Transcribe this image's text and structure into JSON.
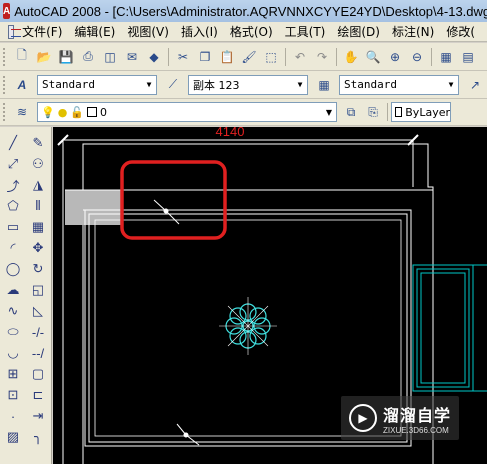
{
  "window": {
    "title": "AutoCAD 2008 - [C:\\Users\\Administrator.AQRVNNXCYYE24YD\\Desktop\\4-13.dwg"
  },
  "menubar": {
    "items": [
      "文件(F)",
      "编辑(E)",
      "视图(V)",
      "插入(I)",
      "格式(O)",
      "工具(T)",
      "绘图(D)",
      "标注(N)",
      "修改("
    ]
  },
  "styles_toolbar": {
    "text_style": "Standard",
    "dim_style": "副本 123",
    "table_style": "Standard"
  },
  "layers_toolbar": {
    "current_layer": "0",
    "color_control": "ByLayer"
  },
  "drawing": {
    "dimension_text": "4140",
    "colors": {
      "background": "#000000",
      "walls": "#ffffff",
      "window": "#00c8c8",
      "fixture": "#40e0e0",
      "highlight": "#e02020",
      "dimension": "#e02020"
    }
  },
  "watermark": {
    "brand": "溜溜自学",
    "url": "ZIXUE.3D66.COM"
  }
}
